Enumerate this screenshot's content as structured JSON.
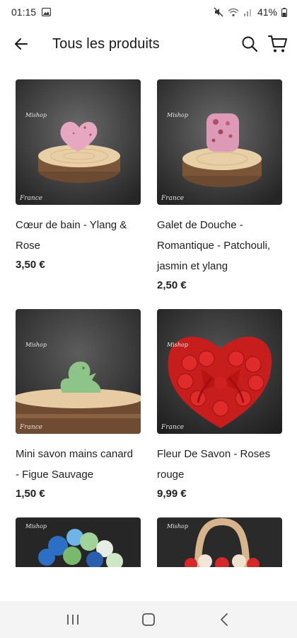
{
  "status_bar": {
    "time": "01:15",
    "battery": "41%"
  },
  "header": {
    "title": "Tous les produits",
    "icons": [
      "back-arrow-icon",
      "search-icon",
      "cart-icon"
    ]
  },
  "products": [
    {
      "name": "Cœur de bain  - Ylang & Rose",
      "price": "3,50 €"
    },
    {
      "name": "Galet de Douche - Romantique - Patchouli, jasmin et ylang",
      "price": "2,50 €"
    },
    {
      "name": "Mini savon mains canard - Figue Sauvage",
      "price": "1,50 €"
    },
    {
      "name": "Fleur De Savon - Roses rouge",
      "price": "9,99 €"
    }
  ],
  "image_marks": {
    "brand": "Mishop",
    "origin": "France"
  },
  "nav": {
    "icons": [
      "recent-apps-icon",
      "home-icon",
      "back-icon"
    ]
  },
  "colors": {
    "background": "#ffffff",
    "text": "#1a1a1a",
    "nav_bar": "#f4f4f4"
  }
}
